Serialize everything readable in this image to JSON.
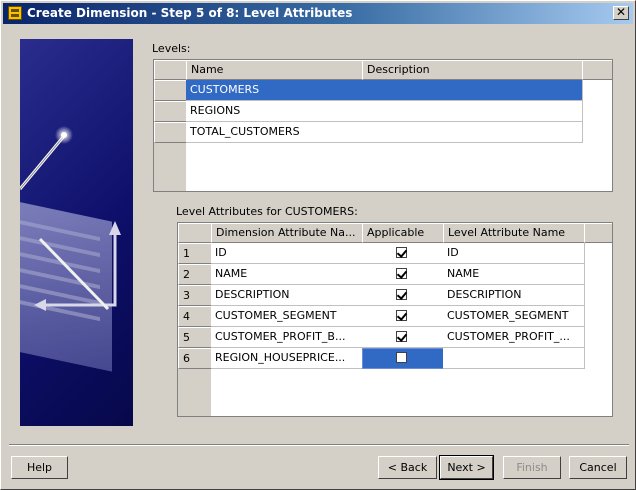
{
  "window": {
    "title": "Create Dimension - Step 5 of 8: Level Attributes",
    "close_glyph": "✕"
  },
  "levels": {
    "label": "Levels:",
    "columns": [
      "Name",
      "Description"
    ],
    "rows": [
      {
        "name": "CUSTOMERS",
        "description": "",
        "selected": true
      },
      {
        "name": "REGIONS",
        "description": ""
      },
      {
        "name": "TOTAL_CUSTOMERS",
        "description": ""
      }
    ]
  },
  "attributes": {
    "label": "Level Attributes for CUSTOMERS:",
    "columns": [
      "Dimension Attribute Na...",
      "Applicable",
      "Level Attribute Name"
    ],
    "rows": [
      {
        "num": "1",
        "dim": "ID",
        "applicable": true,
        "level": "ID"
      },
      {
        "num": "2",
        "dim": "NAME",
        "applicable": true,
        "level": "NAME"
      },
      {
        "num": "3",
        "dim": "DESCRIPTION",
        "applicable": true,
        "level": "DESCRIPTION"
      },
      {
        "num": "4",
        "dim": "CUSTOMER_SEGMENT",
        "applicable": true,
        "level": "CUSTOMER_SEGMENT"
      },
      {
        "num": "5",
        "dim": "CUSTOMER_PROFIT_B...",
        "applicable": true,
        "level": "CUSTOMER_PROFIT_..."
      },
      {
        "num": "6",
        "dim": "REGION_HOUSEPRICE...",
        "applicable": false,
        "level": ""
      }
    ]
  },
  "buttons": {
    "help": "Help",
    "back": "< Back",
    "next": "Next >",
    "finish": "Finish",
    "cancel": "Cancel"
  }
}
